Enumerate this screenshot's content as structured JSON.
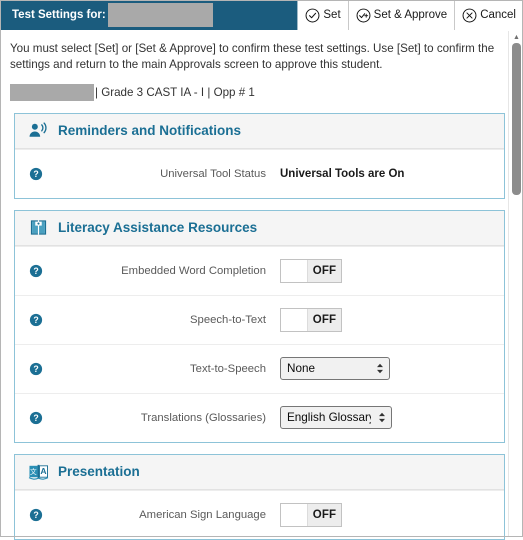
{
  "topbar": {
    "title": "Test Settings for:",
    "student_name_redacted": true,
    "actions": [
      {
        "label": "Set",
        "icon": "check-circle-icon"
      },
      {
        "label": "Set & Approve",
        "icon": "check-plus-circle-icon"
      },
      {
        "label": "Cancel",
        "icon": "x-circle-icon"
      }
    ]
  },
  "instructions": {
    "text": "You must select [Set] or [Set & Approve] to confirm these test settings. Use [Set] to confirm the settings and return to the main Approvals screen to approve this student."
  },
  "breadcrumb": {
    "student_redacted": true,
    "text": "| Grade 3 CAST IA - I | Opp # 1"
  },
  "sections": [
    {
      "title": "Reminders and Notifications",
      "icon": "person-speaking-icon",
      "rows": [
        {
          "help_icon": "question-circle-icon",
          "label": "Universal Tool Status",
          "control": "text",
          "value": "Universal Tools are On"
        }
      ]
    },
    {
      "title": "Literacy Assistance Resources",
      "icon": "open-book-icon",
      "rows": [
        {
          "help_icon": "question-circle-icon",
          "label": "Embedded Word Completion",
          "control": "toggle",
          "value": "OFF"
        },
        {
          "help_icon": "question-circle-icon",
          "label": "Speech-to-Text",
          "control": "toggle",
          "value": "OFF"
        },
        {
          "help_icon": "question-circle-icon",
          "label": "Text-to-Speech",
          "control": "select",
          "value": "None"
        },
        {
          "help_icon": "question-circle-icon",
          "label": "Translations (Glossaries)",
          "control": "select",
          "value": "English Glossary"
        }
      ]
    },
    {
      "title": "Presentation",
      "icon": "translation-book-icon",
      "rows": [
        {
          "help_icon": "question-circle-icon",
          "label": "American Sign Language",
          "control": "toggle",
          "value": "OFF"
        }
      ]
    }
  ],
  "scrollbar": {
    "up_arrow": "▲",
    "down_arrow": "▼"
  },
  "colors": {
    "header_bg": "#1b5c7e",
    "section_border": "#8dc3d8",
    "section_title": "#1b6f94",
    "accent": "#1b6f94",
    "redaction": "#a9a9a9"
  }
}
